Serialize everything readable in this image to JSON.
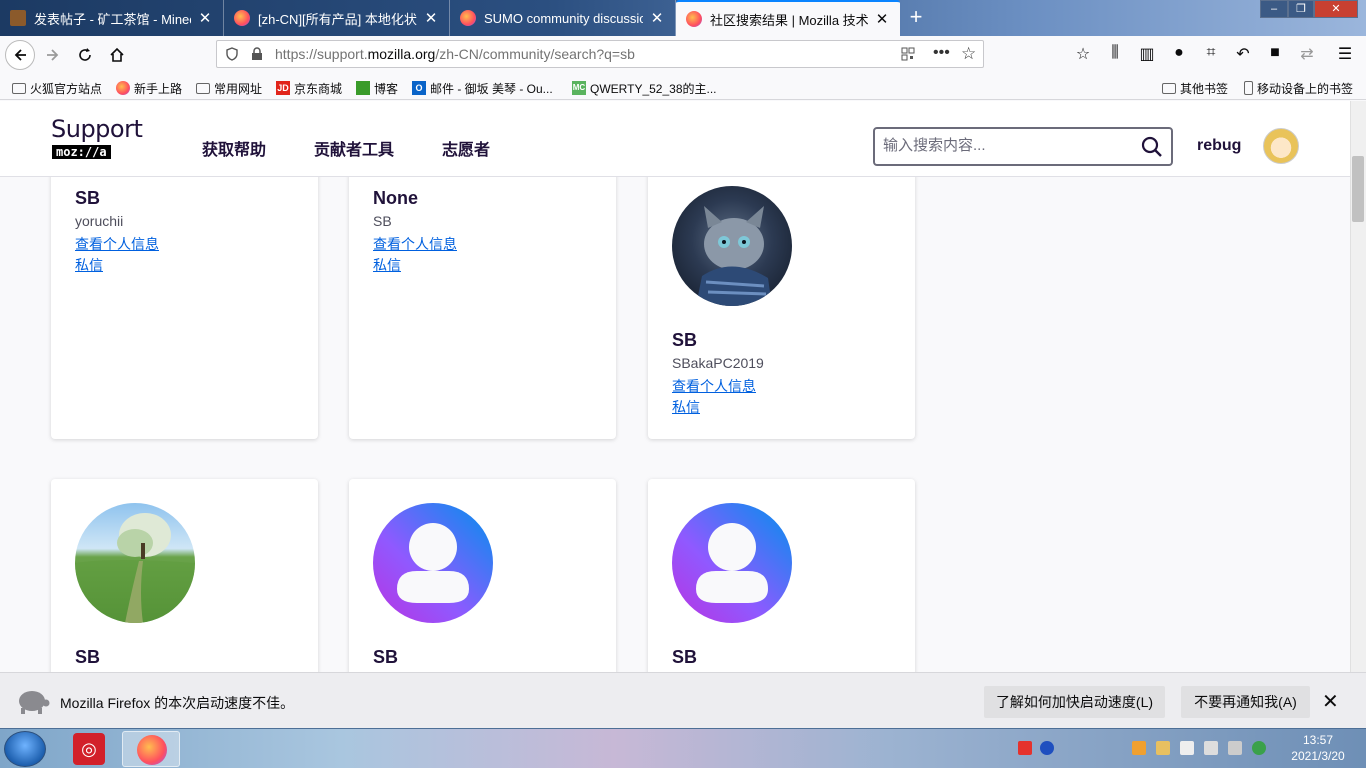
{
  "browser": {
    "tabs": [
      {
        "title": "发表帖子 - 矿工茶馆 - Minecra",
        "favicon": "minecraft-block-icon",
        "active": false
      },
      {
        "title": "[zh-CN][所有产品] 本地化状态",
        "favicon": "firefox-icon",
        "active": false
      },
      {
        "title": "SUMO community discussion",
        "favicon": "firefox-icon",
        "active": false
      },
      {
        "title": "社区搜索结果 | Mozilla 技术支",
        "favicon": "firefox-icon",
        "active": true
      }
    ],
    "close_glyph": "✕",
    "new_tab_glyph": "+",
    "url": {
      "prefix": "https://support.",
      "domain": "mozilla.org",
      "path": "/zh-CN/community/search?q=sb"
    },
    "bookmarks": [
      {
        "label": "火狐官方站点",
        "icon": "folder-icon"
      },
      {
        "label": "新手上路",
        "icon": "firefox-icon"
      },
      {
        "label": "常用网址",
        "icon": "folder-icon"
      },
      {
        "label": "京东商城",
        "icon": "jd-icon"
      },
      {
        "label": "博客",
        "icon": "minecraft-creeper-icon"
      },
      {
        "label": "邮件 - 御坂 美琴 - Ou...",
        "icon": "outlook-icon"
      },
      {
        "label": "QWERTY_52_38的主...",
        "icon": "mcbbs-icon"
      }
    ],
    "bookmarks_right": [
      {
        "label": "其他书签",
        "icon": "folder-icon"
      },
      {
        "label": "移动设备上的书签",
        "icon": "mobile-icon"
      }
    ]
  },
  "site": {
    "logo_top": "Support",
    "logo_bottom": "moz://a",
    "nav": [
      "获取帮助",
      "贡献者工具",
      "志愿者"
    ],
    "search_placeholder": "输入搜索内容...",
    "username": "rebug"
  },
  "cards": [
    {
      "name": "SB",
      "username": "yoruchii",
      "profile_link": "查看个人信息",
      "message_link": "私信",
      "avatar": "none"
    },
    {
      "name": "None",
      "username": "SB",
      "profile_link": "查看个人信息",
      "message_link": "私信",
      "avatar": "none"
    },
    {
      "name": "SB",
      "username": "SBakaPC2019",
      "profile_link": "查看个人信息",
      "message_link": "私信",
      "avatar": "cat-photo"
    },
    {
      "name": "SB",
      "avatar": "landscape-photo"
    },
    {
      "name": "SB",
      "avatar": "default-user-icon"
    },
    {
      "name": "SB",
      "avatar": "default-user-icon"
    }
  ],
  "notification": {
    "text": "Mozilla Firefox 的本次启动速度不佳。",
    "button_learn": "了解如何加快启动速度(L)",
    "button_dismiss": "不要再通知我(A)",
    "close_glyph": "✕"
  },
  "taskbar": {
    "time": "13:57",
    "date": "2021/3/20"
  }
}
